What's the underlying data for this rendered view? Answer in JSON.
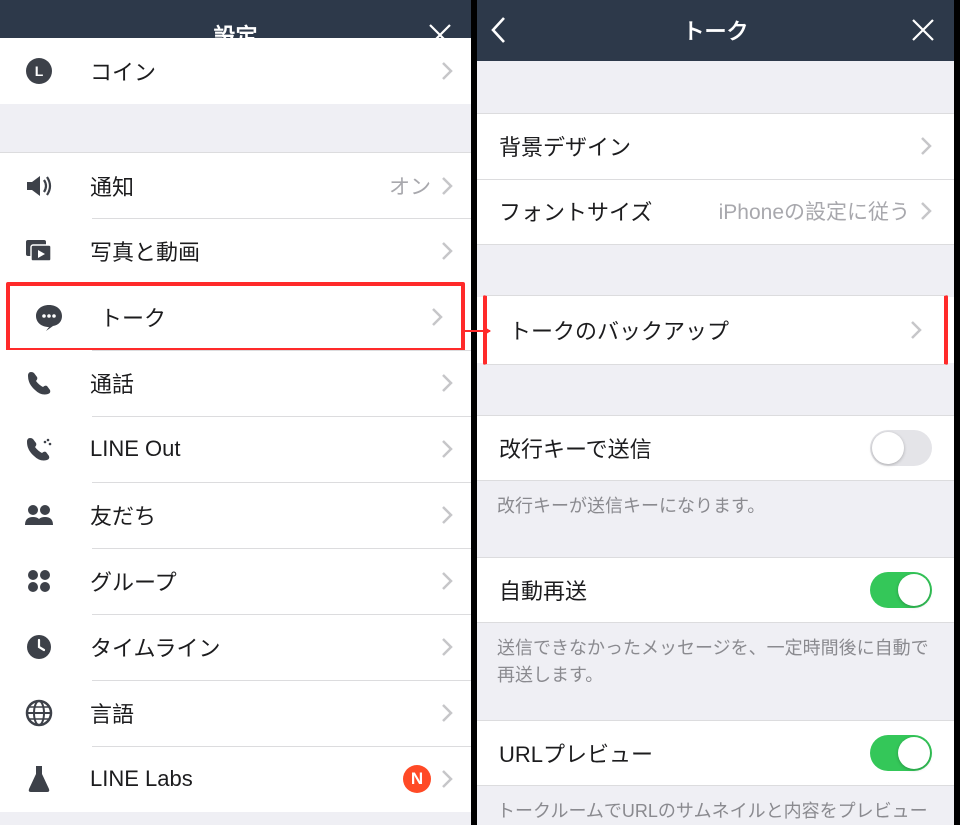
{
  "left": {
    "title": "設定",
    "items": {
      "coin": "コイン",
      "notif": "通知",
      "notif_value": "オン",
      "photo": "写真と動画",
      "talk": "トーク",
      "call": "通話",
      "lineout": "LINE Out",
      "friends": "友だち",
      "groups": "グループ",
      "timeline": "タイムライン",
      "lang": "言語",
      "labs": "LINE Labs",
      "labs_badge": "N"
    }
  },
  "right": {
    "title": "トーク",
    "bg": "背景デザイン",
    "font": "フォントサイズ",
    "font_value": "iPhoneの設定に従う",
    "backup": "トークのバックアップ",
    "enter_send": "改行キーで送信",
    "enter_send_note": "改行キーが送信キーになります。",
    "auto_resend": "自動再送",
    "auto_resend_note": "送信できなかったメッセージを、一定時間後に自動で再送します。",
    "url_preview": "URLプレビュー",
    "url_preview_note": "トークルームでURLのサムネイルと内容をプレビュー"
  }
}
